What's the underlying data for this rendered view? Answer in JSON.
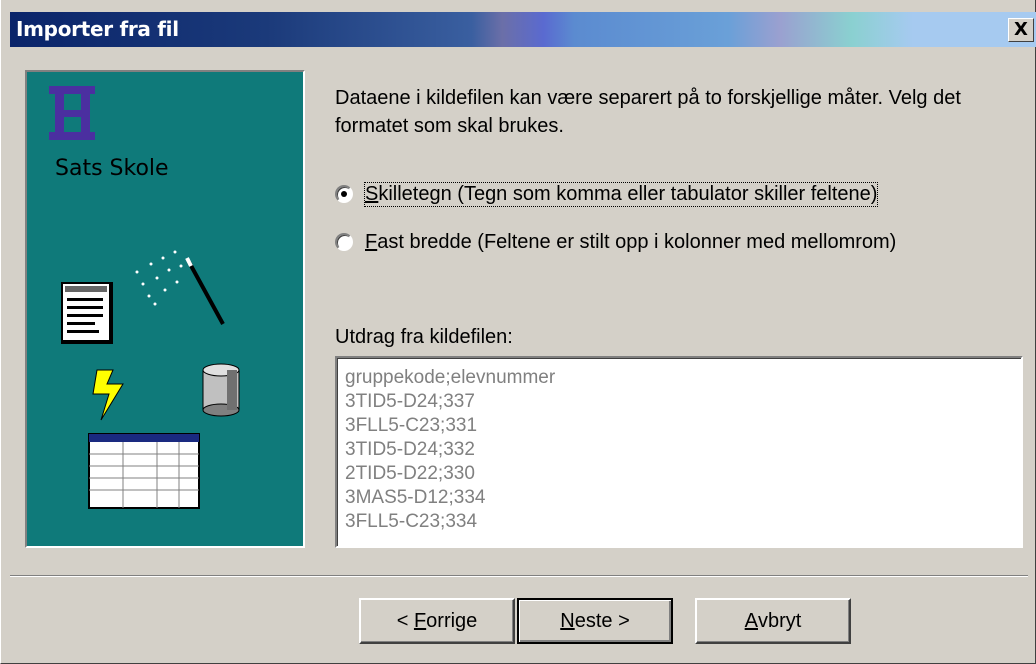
{
  "window": {
    "title": "Importer fra fil",
    "close_label": "X"
  },
  "sidebar": {
    "logo_text": "Sats Skole"
  },
  "main": {
    "intro_text": "Dataene i kildefilen kan være separert på to forskjellige måter. Velg det formatet som skal brukes.",
    "options": [
      {
        "mnemonic": "S",
        "rest": "killetegn (Tegn som komma eller tabulator skiller feltene)",
        "checked": true
      },
      {
        "mnemonic": "F",
        "rest": "ast bredde (Feltene er stilt opp i kolonner med mellomrom)",
        "checked": false
      }
    ],
    "excerpt_label": "Utdrag fra kildefilen:",
    "excerpt_lines": [
      "gruppekode;elevnummer",
      "3TID5-D24;337",
      "3FLL5-C23;331",
      "3TID5-D24;332",
      "2TID5-D22;330",
      "3MAS5-D12;334",
      "3FLL5-C23;334"
    ]
  },
  "buttons": {
    "back_prefix": "< ",
    "back_mnemonic": "F",
    "back_rest": "orrige",
    "next_mnemonic": "N",
    "next_rest": "este >",
    "cancel_mnemonic": "A",
    "cancel_rest": "vbryt"
  },
  "colors": {
    "panel_teal": "#0f7a7a",
    "title_dark": "#0a246a",
    "dialog_bg": "#d4d0c8"
  }
}
